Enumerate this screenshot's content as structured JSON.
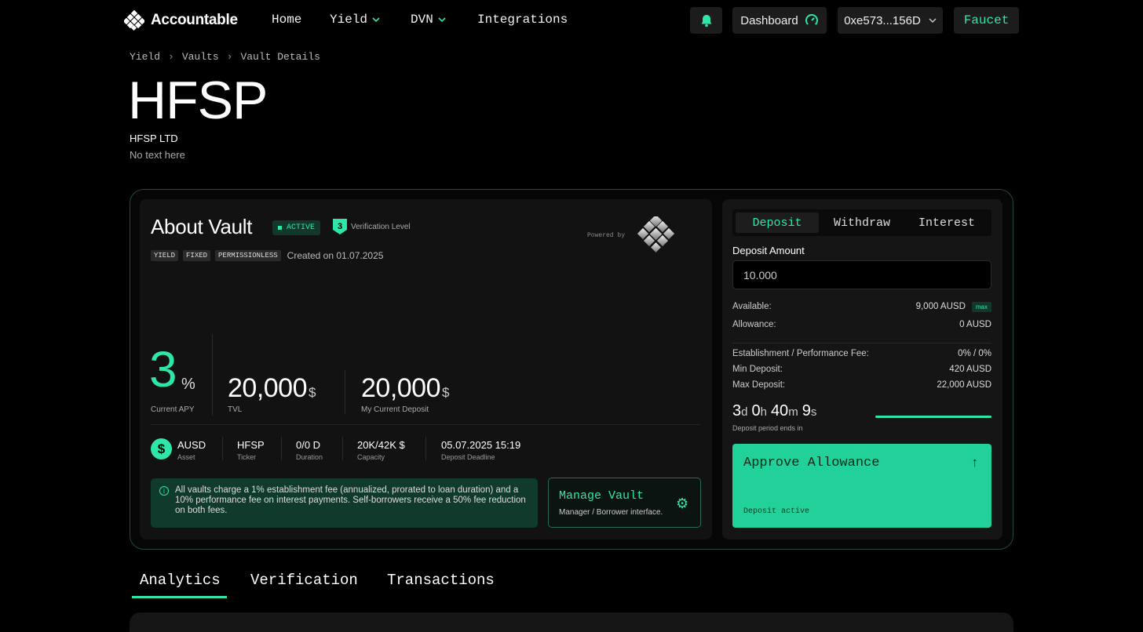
{
  "nav": {
    "brand": "Accountable",
    "links": [
      "Home",
      "Yield",
      "DVN",
      "Integrations"
    ],
    "dashboard": "Dashboard",
    "wallet": "0xe573...156D",
    "faucet": "Faucet"
  },
  "breadcrumb": [
    "Yield",
    "Vaults",
    "Vault Details"
  ],
  "vault": {
    "title": "HFSP",
    "company": "HFSP LTD",
    "description": "No text here"
  },
  "about": {
    "title": "About Vault",
    "status": "ACTIVE",
    "verification_level": "3",
    "verification_label": "Verification Level",
    "powered_by": "Powered by",
    "tags": [
      "YIELD",
      "FIXED",
      "PERMISSIONLESS"
    ],
    "created": "Created on 01.07.2025",
    "apy": "3",
    "apy_unit": "%",
    "apy_label": "Current APY",
    "tvl": "20,000",
    "tvl_unit": "$",
    "tvl_label": "TVL",
    "my_deposit": "20,000",
    "my_deposit_unit": "$",
    "my_deposit_label": "My Current Deposit",
    "stats": [
      {
        "value": "AUSD",
        "label": "Asset"
      },
      {
        "value": "HFSP",
        "label": "Ticker"
      },
      {
        "value": "0/0 D",
        "label": "Duration"
      },
      {
        "value": "20K/42K $",
        "label": "Capacity"
      },
      {
        "value": "05.07.2025 15:19",
        "label": "Deposit Deadline"
      }
    ],
    "fee_note": "All vaults charge a 1% establishment fee (annualized, prorated to loan duration) and a 10% performance fee on interest payments. Self-borrowers receive a 50% fee reduction on both fees.",
    "manage_title": "Manage Vault",
    "manage_sub": "Manager / Borrower interface."
  },
  "panel": {
    "tabs": [
      "Deposit",
      "Withdraw",
      "Interest"
    ],
    "deposit_label": "Deposit Amount",
    "deposit_value": "10.000",
    "available_label": "Available:",
    "available_value": "9,000 AUSD",
    "max_label": "max",
    "allowance_label": "Allowance:",
    "allowance_value": "0 AUSD",
    "fee_label": "Establishment / Performance Fee:",
    "fee_value": "0% / 0%",
    "min_label": "Min Deposit:",
    "min_value": "420 AUSD",
    "max_dep_label": "Max Deposit:",
    "max_dep_value": "22,000 AUSD",
    "countdown": {
      "d": "3",
      "h": "0",
      "m": "40",
      "s": "9"
    },
    "countdown_units": {
      "d": "d",
      "h": "h",
      "m": "m",
      "s": "s"
    },
    "countdown_label": "Deposit period ends in",
    "period_progress": 1.0,
    "approve_title": "Approve Allowance",
    "approve_sub": "Deposit active"
  },
  "bottom_tabs": [
    "Analytics",
    "Verification",
    "Transactions"
  ],
  "colors": {
    "accent": "#2ee6a8",
    "approve": "#22d199",
    "bg": "#000000"
  }
}
